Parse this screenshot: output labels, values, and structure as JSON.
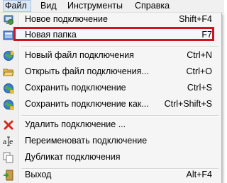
{
  "menubar": {
    "items": [
      {
        "label": "Файл",
        "active": true
      },
      {
        "label": "Вид"
      },
      {
        "label": "Инструменты"
      },
      {
        "label": "Справка"
      }
    ]
  },
  "file_menu": {
    "items": [
      {
        "label": "Новое подключение",
        "shortcut": "Shift+F4",
        "icon": "new-connection-icon",
        "highlighted": true
      },
      {
        "label": "Новая папка",
        "shortcut": "F7",
        "icon": "new-folder-icon"
      },
      {
        "label": "Новый файл подключения",
        "shortcut": "Ctrl+N",
        "icon": "globe-new-file-icon"
      },
      {
        "label": "Открыть файл подключения...",
        "shortcut": "Ctrl+O",
        "icon": "open-folder-icon"
      },
      {
        "label": "Сохранить подключение",
        "shortcut": "Ctrl+S",
        "icon": "globe-save-icon"
      },
      {
        "label": "Сохранить подключение как...",
        "shortcut": "Ctrl+Shift+S",
        "icon": "globe-save-as-icon"
      },
      {
        "label": "Удалить подключение ...",
        "shortcut": "",
        "icon": "delete-icon"
      },
      {
        "label": "Переименовать подключение",
        "shortcut": "",
        "icon": "rename-icon"
      },
      {
        "label": "Дубликат подключения",
        "shortcut": "",
        "icon": "duplicate-icon"
      },
      {
        "label": "Выход",
        "shortcut": "Alt+F4",
        "icon": "exit-icon"
      }
    ]
  },
  "colors": {
    "highlight_border": "#d0131d",
    "menu_background": "#f5f5f5",
    "gutter_background": "#f0f0f0"
  }
}
